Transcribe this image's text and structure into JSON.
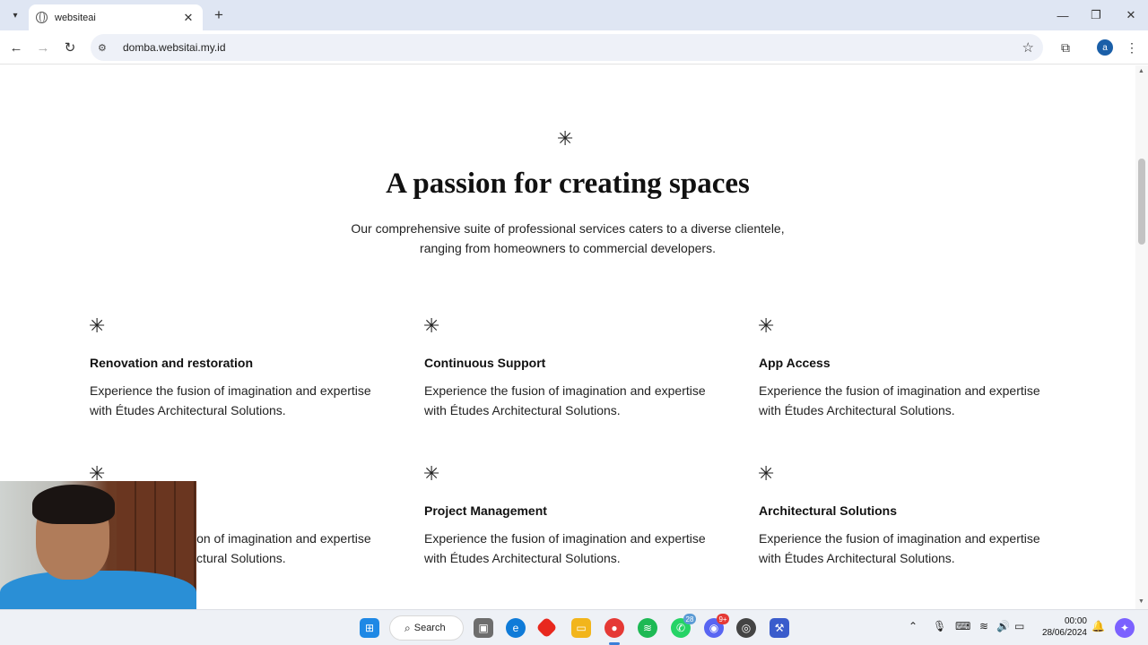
{
  "browser": {
    "tab_title": "websiteai",
    "url": "domba.websitai.my.id",
    "profile_initial": "a"
  },
  "page": {
    "ornament": "✳",
    "heading": "A passion for creating spaces",
    "intro": "Our comprehensive suite of professional services caters to a diverse clientele, ranging from homeowners to commercial developers.",
    "services": [
      {
        "title": "Renovation and restoration",
        "desc": "Experience the fusion of imagination and expertise with Études Architectural Solutions."
      },
      {
        "title": "Continuous Support",
        "desc": "Experience the fusion of imagination and expertise with Études Architectural Solutions."
      },
      {
        "title": "App Access",
        "desc": "Experience the fusion of imagination and expertise with Études Architectural Solutions."
      },
      {
        "title": "",
        "desc": "Experience the fusion of imagination and expertise with Études Architectural Solutions."
      },
      {
        "title": "Project Management",
        "desc": "Experience the fusion of imagination and expertise with Études Architectural Solutions."
      },
      {
        "title": "Architectural Solutions",
        "desc": "Experience the fusion of imagination and expertise with Études Architectural Solutions."
      }
    ]
  },
  "taskbar": {
    "search_label": "Search",
    "whatsapp_badge": "28",
    "discord_badge": "9+",
    "time": "00:00",
    "date": "28/06/2024"
  },
  "colors": {
    "tabstrip": "#dfe6f3",
    "omnibox": "#eef1f8",
    "taskbar": "#eef1f6",
    "accent": "#1a5fa8"
  }
}
